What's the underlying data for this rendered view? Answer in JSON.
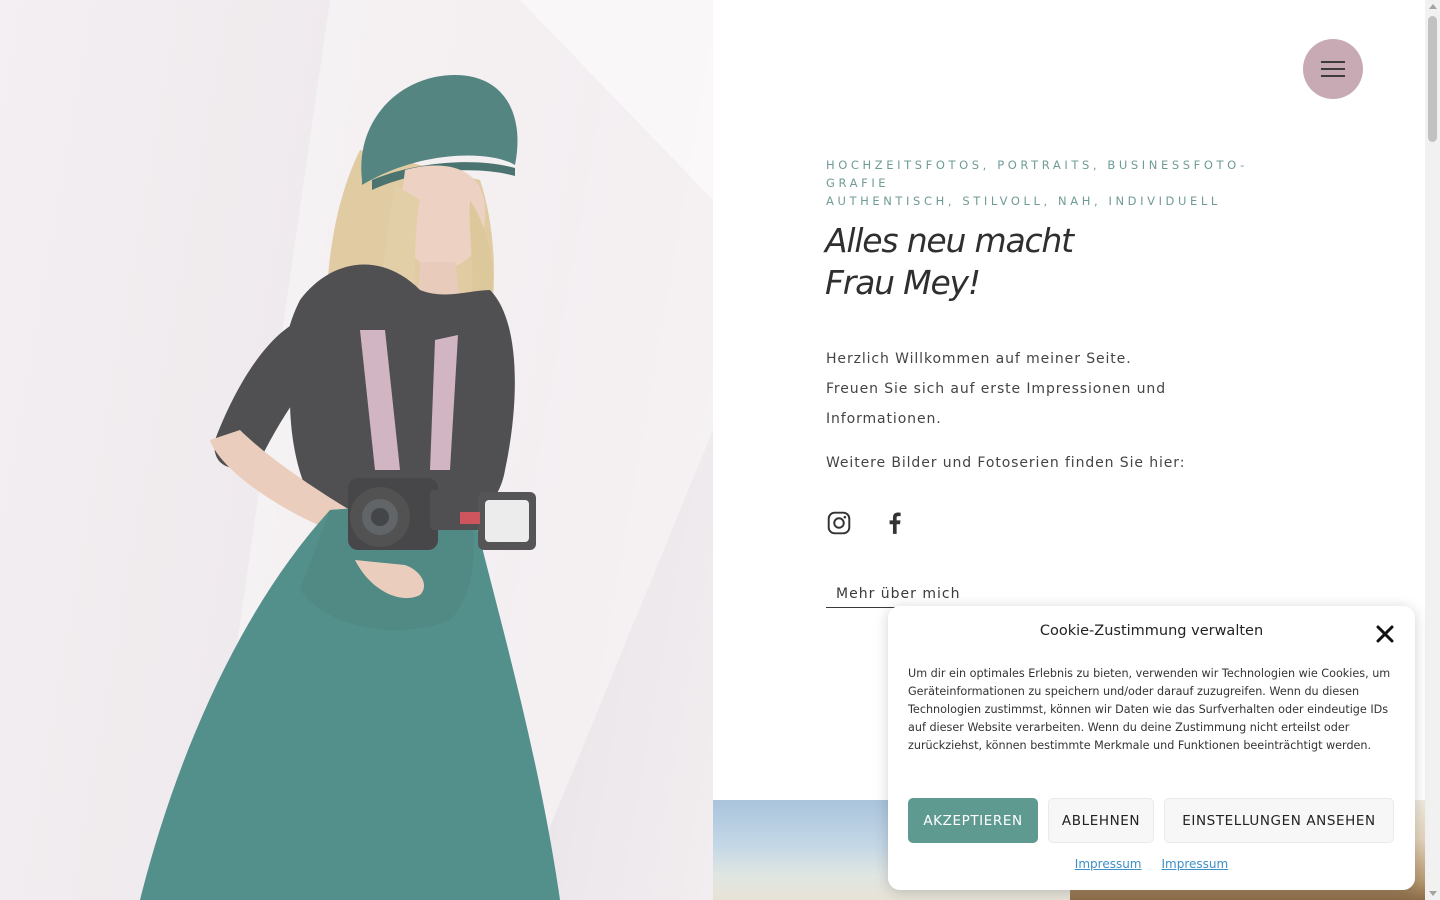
{
  "header": {
    "menu_icon": "hamburger-icon",
    "menu_button_color": "#c7aab4"
  },
  "hero": {
    "photo_description_icon": "photographer-photo",
    "tagline_line1": "HOCHZEITSFOTOS, PORTRAITS, BUSINESSFOTO-",
    "tagline_line2": "GRAFIE",
    "tagline_line3": "AUTHENTISCH, STILVOLL, NAH, INDIVIDUELL",
    "headline_line1": "Alles neu macht",
    "headline_line2": "Frau Mey!",
    "intro_line1": "Herzlich Willkommen auf meiner Seite.",
    "intro_line2": "Freuen Sie sich auf erste Impressionen und",
    "intro_line3": "Informationen.",
    "more_text": "Weitere Bilder und Fotoserien finden Sie hier:",
    "social": {
      "instagram_icon": "instagram-icon",
      "facebook_icon": "facebook-icon"
    },
    "about_link": "Mehr über mich",
    "accent_color": "#6f9b96"
  },
  "cookie": {
    "title": "Cookie-Zustimmung verwalten",
    "text": "Um dir ein optimales Erlebnis zu bieten, verwenden wir Technologien wie Cookies, um Geräteinformationen zu speichern und/oder darauf zuzugreifen. Wenn du diesen Technologien zustimmst, können wir Daten wie das Surfverhalten oder eindeutige IDs auf dieser Website verarbeiten. Wenn du deine Zustimmung nicht erteilst oder zurückziehst, können bestimmte Merkmale und Funktionen beeinträchtigt werden.",
    "accept_label": "AKZEPTIEREN",
    "deny_label": "ABLEHNEN",
    "settings_label": "EINSTELLUNGEN ANSEHEN",
    "link1": "Impressum",
    "link2": "Impressum",
    "accept_color": "#5f9a91",
    "link_color": "#3d8fc6"
  }
}
